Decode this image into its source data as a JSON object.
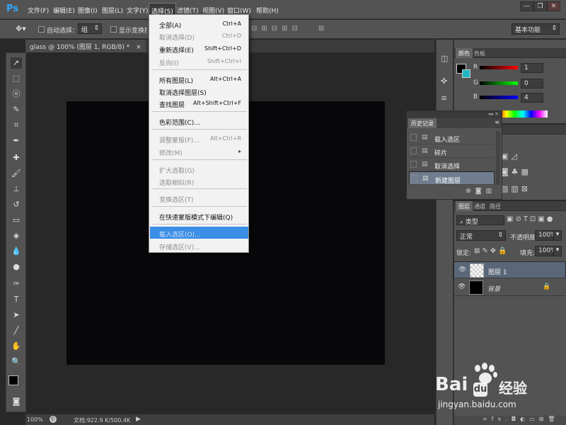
{
  "app": {
    "logo": "Ps"
  },
  "menubar": {
    "items": [
      "文件(F)",
      "编辑(E)",
      "图像(I)",
      "图层(L)",
      "文字(Y)",
      "选择(S)",
      "滤镜(T)",
      "视图(V)",
      "窗口(W)",
      "帮助(H)"
    ],
    "active": "选择(S)"
  },
  "window_controls": {
    "minimize": "—",
    "restore": "❐",
    "close": "✕"
  },
  "options_bar": {
    "auto_select_label": "自动选择：",
    "auto_select_value": "组",
    "show_transform_label": "显示变换控件",
    "workspace": "基本功能"
  },
  "document": {
    "tab_title": "glass @ 100% (图层 1, RGB/8) *",
    "tab_close": "×",
    "zoom": "100%",
    "doc_info": "文档:922.9 K/500.4K"
  },
  "select_menu": {
    "items": [
      {
        "label": "全部(A)",
        "shortcut": "Ctrl+A",
        "disabled": false
      },
      {
        "label": "取消选择(D)",
        "shortcut": "Ctrl+D",
        "disabled": true
      },
      {
        "label": "重新选择(E)",
        "shortcut": "Shift+Ctrl+D",
        "disabled": false
      },
      {
        "label": "反向(I)",
        "shortcut": "Shift+Ctrl+I",
        "disabled": true
      },
      {
        "label": "所有图层(L)",
        "shortcut": "Alt+Ctrl+A",
        "disabled": false
      },
      {
        "label": "取消选择图层(S)",
        "shortcut": "",
        "disabled": false
      },
      {
        "label": "查找图层",
        "shortcut": "Alt+Shift+Ctrl+F",
        "disabled": false
      },
      {
        "label": "色彩范围(C)...",
        "shortcut": "",
        "disabled": false
      },
      {
        "label": "调整蒙版(F)...",
        "shortcut": "Alt+Ctrl+R",
        "disabled": true
      },
      {
        "label": "修改(M)",
        "shortcut": "▸",
        "disabled": true
      },
      {
        "label": "扩大选取(G)",
        "shortcut": "",
        "disabled": true
      },
      {
        "label": "选取相似(R)",
        "shortcut": "",
        "disabled": true
      },
      {
        "label": "变换选区(T)",
        "shortcut": "",
        "disabled": true
      },
      {
        "label": "在快速蒙版模式下编辑(Q)",
        "shortcut": "",
        "disabled": false
      },
      {
        "label": "载入选区(O)...",
        "shortcut": "",
        "disabled": false,
        "highlighted": true
      },
      {
        "label": "存储选区(V)...",
        "shortcut": "",
        "disabled": true
      }
    ]
  },
  "color_panel": {
    "tabs": [
      "颜色",
      "色板"
    ],
    "r_label": "R",
    "r_value": "1",
    "g_label": "G",
    "g_value": "0",
    "b_label": "B",
    "b_value": "4"
  },
  "history_panel": {
    "title": "历史记录",
    "items": [
      "载入选区",
      "碎片",
      "取消选择",
      "新建图层"
    ],
    "selected": "新建图层"
  },
  "layers_panel": {
    "tabs": [
      "图层",
      "通道",
      "路径"
    ],
    "filter_kind": "类型",
    "blend_mode": "正常",
    "opacity_label": "不透明度:",
    "opacity_value": "100%",
    "lock_label": "锁定:",
    "fill_label": "填充:",
    "fill_value": "100%",
    "layers": [
      {
        "name": "图层 1",
        "selected": true
      },
      {
        "name": "背景",
        "selected": false
      }
    ],
    "footer": {
      "fx": "fx."
    }
  },
  "watermark": {
    "brand": "Bai",
    "brand_tail": "经验",
    "url": "jingyan.baidu.com"
  },
  "colors": {
    "menu_highlight": "#3a8ee6",
    "layer_selected": "#5a6778",
    "foreground": "#000000",
    "background_swatch": "#1fb7c2",
    "brand_blue": "#31a8ff"
  }
}
